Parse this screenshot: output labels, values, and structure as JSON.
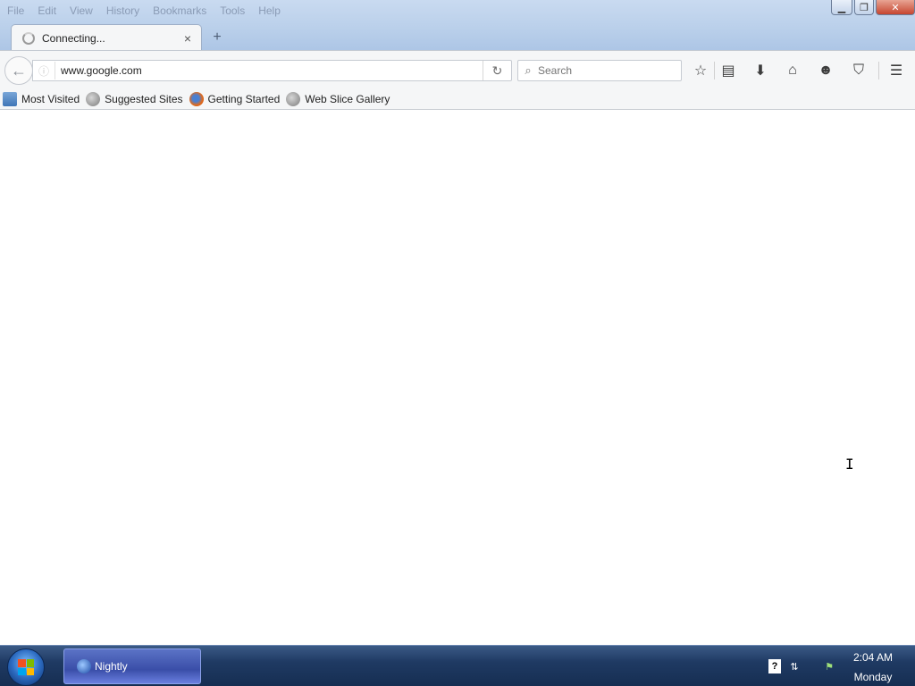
{
  "menubar": {
    "items": [
      "File",
      "Edit",
      "View",
      "History",
      "Bookmarks",
      "Tools",
      "Help"
    ]
  },
  "window_controls": {
    "minimize": "▁",
    "maximize": "❐",
    "close": "✕"
  },
  "tab": {
    "title": "Connecting...",
    "close_glyph": "×",
    "state_icon": "loading-spinner-icon"
  },
  "newtab_glyph": "+",
  "navbar": {
    "back_glyph": "←",
    "info_glyph": "ⓘ",
    "url": "www.google.com",
    "reload_glyph": "↻",
    "search_placeholder": "Search",
    "search_glyph": "⌕",
    "icons": [
      "star-icon",
      "reading-list-icon",
      "download-icon",
      "home-icon",
      "smiley-icon",
      "pocket-icon",
      "hamburger-menu-icon"
    ],
    "icon_glyphs": {
      "star": "☆",
      "reading_list": "▤",
      "download": "⬇",
      "home": "⌂",
      "smiley": "☻",
      "pocket": "⛉",
      "menu": "☰"
    }
  },
  "bookmarks": {
    "items": [
      "Most Visited",
      "Suggested Sites",
      "Getting Started",
      "Web Slice Gallery"
    ]
  },
  "taskbar": {
    "task_label": "Nightly",
    "tray": {
      "help_glyph": "?",
      "network_glyph": "⇅",
      "flag_glyph": "⚑"
    },
    "clock": {
      "time": "2:04 AM",
      "day": "Monday"
    }
  },
  "colors": {
    "titlebar": "#b9cfea",
    "toolbar": "#f5f6f7",
    "taskbar": "#1f3a63",
    "close_button": "#c6452f"
  }
}
